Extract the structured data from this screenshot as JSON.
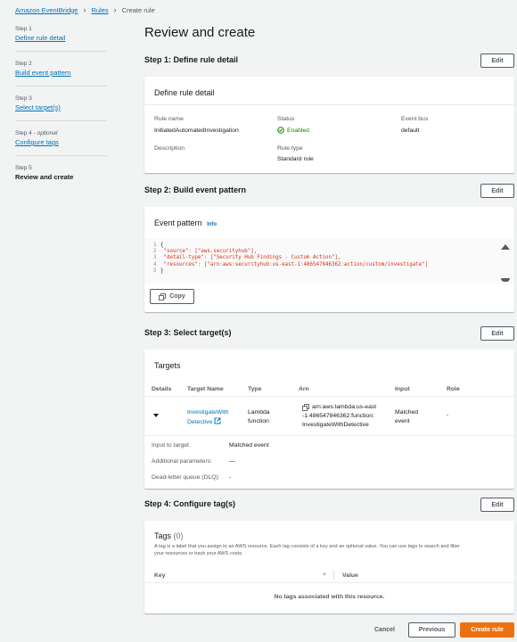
{
  "breadcrumb": {
    "items": [
      "Amazon EventBridge",
      "Rules"
    ],
    "current": "Create rule"
  },
  "steps": [
    {
      "label": "Step 1",
      "name": "Define rule detail"
    },
    {
      "label": "Step 2",
      "name": "Build event pattern"
    },
    {
      "label": "Step 3",
      "name": "Select target(s)"
    },
    {
      "label": "Step 4",
      "optional": "optional",
      "name": "Configure tags"
    },
    {
      "label": "Step 5",
      "name": "Review and create"
    }
  ],
  "page_title": "Review and create",
  "edit_label": "Edit",
  "step1": {
    "title": "Step 1: Define rule detail",
    "panel_title": "Define rule detail",
    "rule_name_label": "Rule name",
    "rule_name": "InitiatedAutomatedInvestigation",
    "status_label": "Status",
    "status": "Enabled",
    "event_bus_label": "Event bus",
    "event_bus": "default",
    "description_label": "Description",
    "rule_type_label": "Rule type",
    "rule_type": "Standard rule"
  },
  "step2": {
    "title": "Step 2: Build event pattern",
    "panel_title": "Event pattern",
    "info": "Info",
    "code": [
      {
        "n": "1",
        "text": "{"
      },
      {
        "n": "2",
        "text": "  \"source\": [\"aws.securityhub\"],"
      },
      {
        "n": "3",
        "text": "  \"detail-type\": [\"Security Hub Findings - Custom Action\"],"
      },
      {
        "n": "4",
        "text": "  \"resources\": [\"arn:aws:securityhub:us-east-1:486547846362:action/custom/investigate\"]"
      },
      {
        "n": "5",
        "text": "}"
      }
    ],
    "copy": "Copy"
  },
  "step3": {
    "title": "Step 3: Select target(s)",
    "panel_title": "Targets",
    "headers": [
      "Details",
      "Target Name",
      "Type",
      "Arn",
      "Input",
      "Role"
    ],
    "target_name_1": "InvestigateWith",
    "target_name_2": "Detective",
    "type_1": "Lambda",
    "type_2": "function",
    "arn_1": "arn:aws:lambda:us-east",
    "arn_2": "-1:486547846362:function:",
    "arn_3": "InvestigateWithDetective",
    "input_1": "Matched",
    "input_2": "event",
    "role": "-",
    "input_to_target_label": "Input to target:",
    "input_to_target": "Matched event",
    "additional_label": "Additional parameters:",
    "additional": "—",
    "dlq_label": "Dead-letter queue (DLQ):",
    "dlq": "-"
  },
  "step4": {
    "title": "Step 4: Configure tag(s)",
    "panel_title": "Tags",
    "count": "(0)",
    "desc_1": "A tag is a label that you assign to an AWS resource. Each tag consists of a key and an optional value. You can use tags to search and filter",
    "desc_2": "your resources or track your AWS costs.",
    "key_header": "Key",
    "value_header": "Value",
    "empty": "No tags associated with this resource."
  },
  "footer": {
    "cancel": "Cancel",
    "previous": "Previous",
    "create": "Create rule"
  },
  "colors": {
    "link": "#0073bb",
    "enabled": "#1d8102",
    "primary": "#ec7211"
  }
}
